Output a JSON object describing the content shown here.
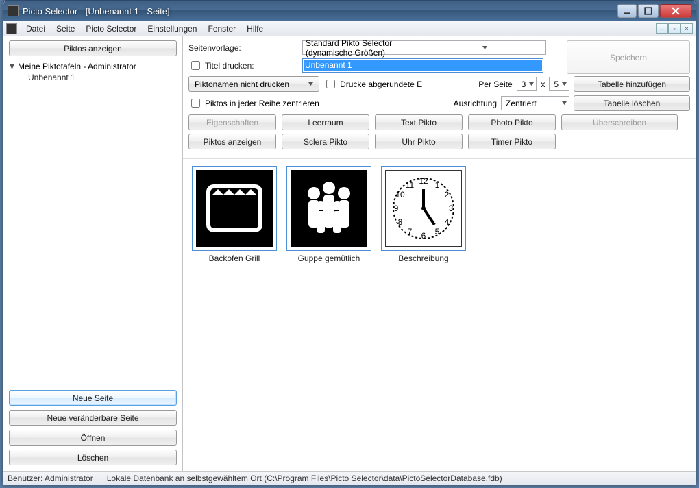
{
  "window": {
    "title": "Picto Selector - [Unbenannt 1 - Seite]"
  },
  "menu": [
    "Datei",
    "Seite",
    "Picto Selector",
    "Einstellungen",
    "Fenster",
    "Hilfe"
  ],
  "sidebar": {
    "show_piktos_btn": "Piktos anzeigen",
    "tree_root": "Meine Piktotafeln - Administrator",
    "tree_child": "Unbenannt 1",
    "buttons": {
      "new_page": "Neue Seite",
      "new_editable": "Neue veränderbare Seite",
      "open": "Öffnen",
      "delete": "Löschen"
    }
  },
  "form": {
    "template_label": "Seitenvorlage:",
    "template_value": "Standard Pikto Selector (dynamische Größen)",
    "title_label": "Titel drucken:",
    "title_value": "Unbenannt 1",
    "save_btn": "Speichern",
    "piktoname_dd": "Piktonamen nicht drucken",
    "rounded_chk": "Drucke abgerundete E",
    "per_page_label": "Per Seite",
    "per_page_cols": "3",
    "per_page_x": "x",
    "per_page_rows": "5",
    "add_table_btn": "Tabelle hinzufügen",
    "centered_chk": "Piktos in jeder Reihe zentrieren",
    "orientation_label": "Ausrichtung",
    "orientation_value": "Zentriert",
    "delete_table_btn": "Tabelle löschen",
    "btns": {
      "properties": "Eigenschaften",
      "space": "Leerraum",
      "text": "Text Pikto",
      "photo": "Photo Pikto",
      "overwrite": "Überschreiben",
      "show": "Piktos anzeigen",
      "sclera": "Sclera Pikto",
      "clock": "Uhr Pikto",
      "timer": "Timer Pikto"
    }
  },
  "piktos": [
    {
      "name": "Backofen Grill",
      "type": "oven"
    },
    {
      "name": "Guppe gemütlich",
      "type": "group"
    },
    {
      "name": "Beschreibung",
      "type": "clock"
    }
  ],
  "status": {
    "user": "Benutzer: Administrator",
    "db": "Lokale Datenbank an selbstgewähltem Ort (C:\\Program Files\\Picto Selector\\data\\PictoSelectorDatabase.fdb)"
  }
}
